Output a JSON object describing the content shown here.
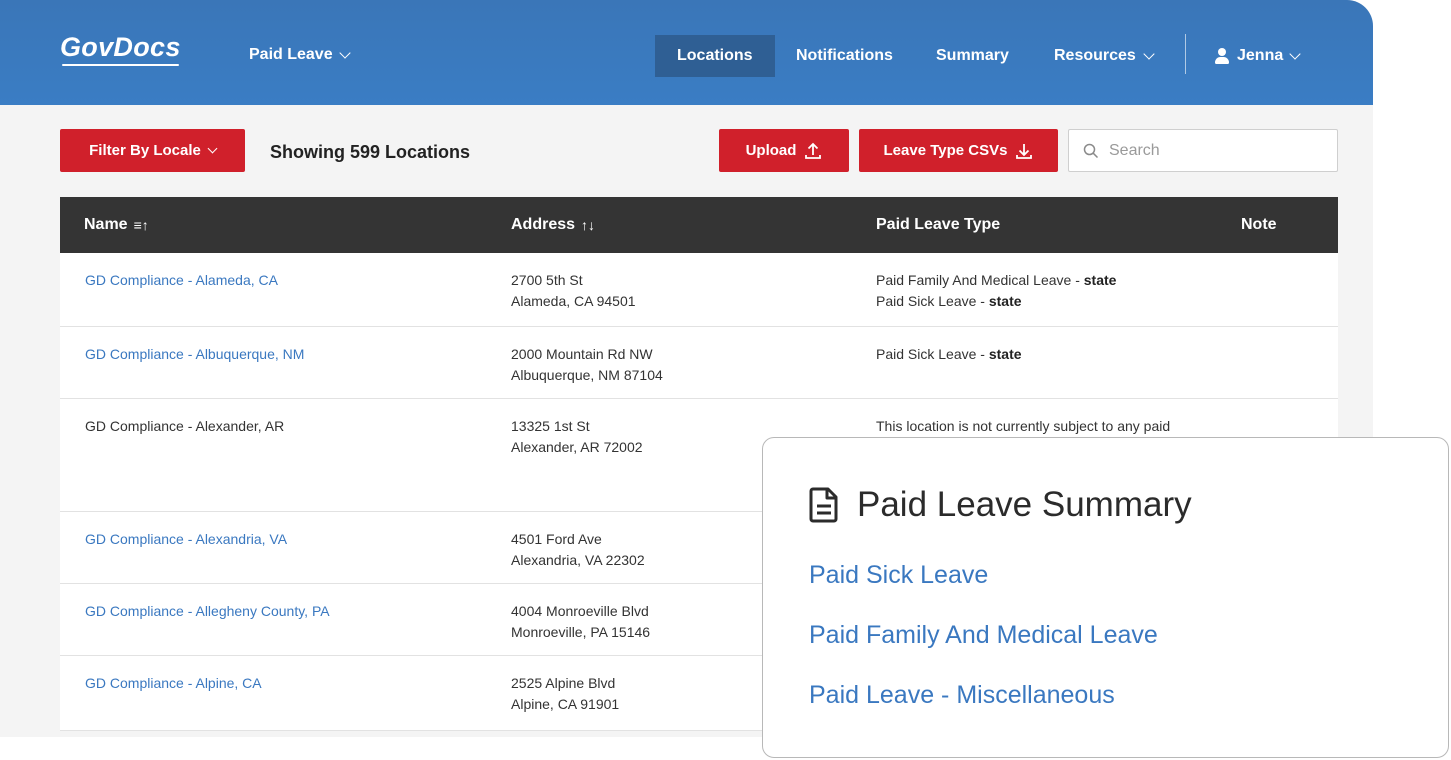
{
  "header": {
    "logo": "GovDocs",
    "product": "Paid Leave",
    "nav": [
      {
        "label": "Locations",
        "active": true
      },
      {
        "label": "Notifications",
        "active": false
      },
      {
        "label": "Summary",
        "active": false
      },
      {
        "label": "Resources",
        "active": false,
        "dropdown": true
      }
    ],
    "user": "Jenna"
  },
  "toolbar": {
    "filter_label": "Filter By Locale",
    "showing": "Showing 599 Locations",
    "upload_label": "Upload",
    "csv_label": "Leave Type CSVs",
    "search_placeholder": "Search"
  },
  "table": {
    "headers": {
      "name": "Name",
      "address": "Address",
      "type": "Paid Leave Type",
      "note": "Note"
    },
    "sort_icons": {
      "name": "≡↑",
      "address": "↑↓"
    },
    "rows": [
      {
        "name": "GD Compliance - Alameda, CA",
        "link": true,
        "addr1": "2700 5th St",
        "addr2": "Alameda, CA 94501",
        "types": [
          {
            "label": "Paid Family And Medical Leave - ",
            "scope": "state"
          },
          {
            "label": "Paid Sick Leave - ",
            "scope": "state"
          }
        ]
      },
      {
        "name": "GD Compliance - Albuquerque, NM",
        "link": true,
        "addr1": "2000 Mountain Rd NW",
        "addr2": "Albuquerque, NM 87104",
        "types": [
          {
            "label": "Paid Sick Leave - ",
            "scope": "state"
          }
        ]
      },
      {
        "name": "GD Compliance - Alexander, AR",
        "link": false,
        "addr1": "13325 1st St",
        "addr2": "Alexander, AR 72002",
        "note_text": "This location is not currently subject to any paid"
      },
      {
        "name": "GD Compliance - Alexandria, VA",
        "link": true,
        "addr1": "4501 Ford Ave",
        "addr2": "Alexandria, VA 22302"
      },
      {
        "name": "GD Compliance - Allegheny County, PA",
        "link": true,
        "addr1": "4004 Monroeville Blvd",
        "addr2": "Monroeville, PA 15146"
      },
      {
        "name": "GD Compliance - Alpine, CA",
        "link": true,
        "addr1": "2525 Alpine Blvd",
        "addr2": "Alpine, CA 91901"
      }
    ]
  },
  "summary_card": {
    "title": "Paid Leave Summary",
    "links": [
      "Paid Sick Leave",
      "Paid Family And Medical Leave",
      "Paid Leave - Miscellaneous"
    ]
  },
  "colors": {
    "header_blue": "#3a7dc4",
    "accent_red": "#d0202b",
    "link_blue": "#3a78c0",
    "table_header": "#343434"
  }
}
